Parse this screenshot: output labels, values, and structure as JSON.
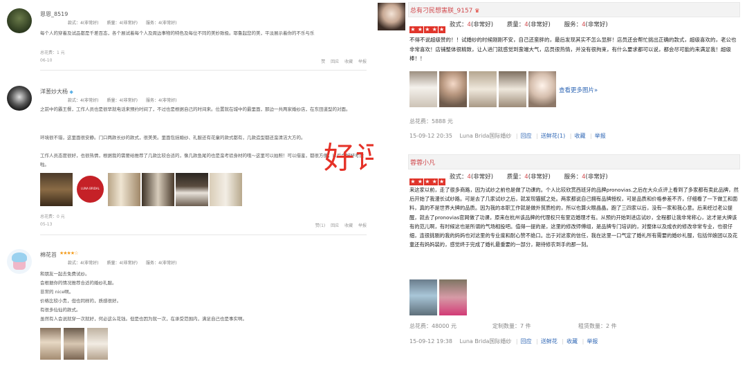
{
  "left": {
    "reviews": [
      {
        "user": "恩恩_8519",
        "ratings": "款式：4(非常好)　　质量：4(非常好)　　服务：4(非常好)",
        "text": "每个人的穿着及试品都是千差百态，各个展试着每个人及周边事物的特色及每位不同的美妙致极。耶鲁起您的美，平淡展示着你的不乐与乐",
        "cost": "总花费：1 元",
        "date": "06-10",
        "actions": "赞 回应 收藏 举报"
      },
      {
        "user": "洋葱炒大杨",
        "ratings": "款式：4(非常好)　　质量：4(非常好)　　服务：4(非常好)",
        "text_lines": [
          "之前中的霸王餐，工作人员也是很早就电话来预约时间了，不过也是根据自己的时间来。位置就在城中的最里面，那边一共两家婚纱店，在东田道型的对面。",
          "环境很不错，这里面很安静。门口两款长纱的款式，很美美。里面包括婚纱、礼服还有花童的款式都有，几款造型都还蛮清洁大方的。",
          "工作人员态度很好，也很热情，根据我的需要给推荐了几款比较合适的，像几款鱼尾的也是蛮考验身材的哦～这里可以拍照！可以借鉴，都很方便，以后会好好考虑啦。"
        ],
        "cost": "总花费：0 元",
        "date": "05-13",
        "actions": "赞(1) 回应 收藏 举报"
      },
      {
        "user": "棉花苔",
        "stars": "★★★★☆",
        "ratings": "款式：4(非常好)　　质量：4(非常好)　　服务：4(非常好)",
        "text_lines": [
          "和朋友一起去免费试纱。",
          "会根据你的情况推荐合适的婚纱礼服。",
          "非常的 nice啊。",
          "价格比较小贵，但也同样的，质感很好。",
          "有很多仙仙的款式。",
          "虽然有人会说就穿一次就好，何必这么花钱。但是也因为就一次，在承受范围内，满足自己也是事实啊。"
        ]
      }
    ]
  },
  "overlay": {
    "text": "好评！"
  },
  "right": {
    "reviews": [
      {
        "user": "总有刁民想害朕_9157",
        "stars": "★★★★★",
        "scores": {
          "style_label": "款式：",
          "style": "4",
          "style_desc": "(非常好)",
          "quality_label": "质量：",
          "quality": "4",
          "quality_desc": "(非常好)",
          "service_label": "服务：",
          "service": "4",
          "service_desc": "(非常好)"
        },
        "text": "不得不说超级赞的！！试婚纱的时候刚刚不安，自己还蛮胖的，最后发现其实不怎么显胖！店员还会帮忙挑出正确的款式，超级喜欢的，老公也非常喜欢！店铺整体很精致，让人进门就感觉到蛮端大气，店员很热情，并没有很拘束，有什么要求都可以说，都会尽可能的来满足我！超级棒！！",
        "more_link": "查看更多图片»",
        "cost": "总花费：5888 元",
        "meta": {
          "datetime": "15-09-12 20:35",
          "shop": "Luna Brida国际婚纱",
          "reply": "回应",
          "flower": "送鲜花",
          "flower_count": "(1)",
          "fav": "收藏",
          "report": "举报"
        }
      },
      {
        "user": "蓉蓉小凡",
        "stars": "★★★★★",
        "scores": {
          "style_label": "款式：",
          "style": "4",
          "style_desc": "(非常好)",
          "quality_label": "质量：",
          "quality": "4",
          "quality_desc": "(非常好)",
          "service_label": "服务：",
          "service": "4",
          "service_desc": "(非常好)"
        },
        "text": "来这家以前，走了很多商路，因为试纱之前也是做了功课的。个人比较欣赏西班牙的品牌pronovias.之后在大众点评上看到了多家都有卖此品牌，然后开始了我漫长试纱路。可是去了几家试纱之后，就发现猫腻之处。两家都说自己拥有品牌授权，可是品质和价格参差不齐，仔细看了一下做工和面料，真的不是世界大牌的品质。因为我的本职工作就是做外贸质检的，所以也算火眼晶晶。跑了三四家以后，没有一家和我心意。后来经过老公提醒，就去了pronovias官网做了功课，原来在杭州该品牌的代理权只有里迈婚理才有。从预约开始到进店试纱，全程都让我非常称心，这才是大牌该有的范儿啊，有时候这也是所谓的气场相投吧。值得一提的是，这里的修改师傅组，是品牌专门培训的，对整体以及成衣的修改非常专业，也很仔细，连很挑剔的我的妈妈也对这里的专业度和耐心赞不绝口。出于对这家的信任，我在这里一口气定了婚礼所有需要的婚纱礼服，包括伴娘团以及花童还有妈妈装的，感觉终于完成了婚礼最重要的一部分，期待修农到手的那一刻。",
        "cost": "总花费：48000 元",
        "custom": "定制数量：7 件",
        "rent": "租赁数量：2 件",
        "meta": {
          "datetime": "15-09-12 19:38",
          "shop": "Luna Brida国际婚纱",
          "reply": "回应",
          "flower": "送鲜花",
          "flower_count": "",
          "fav": "收藏",
          "report": "举报"
        }
      }
    ]
  },
  "colors": {
    "accent_red": "#e53228",
    "link_blue": "#2f67b5",
    "star_red": "#e0342a",
    "star_orange": "#f39a19"
  }
}
